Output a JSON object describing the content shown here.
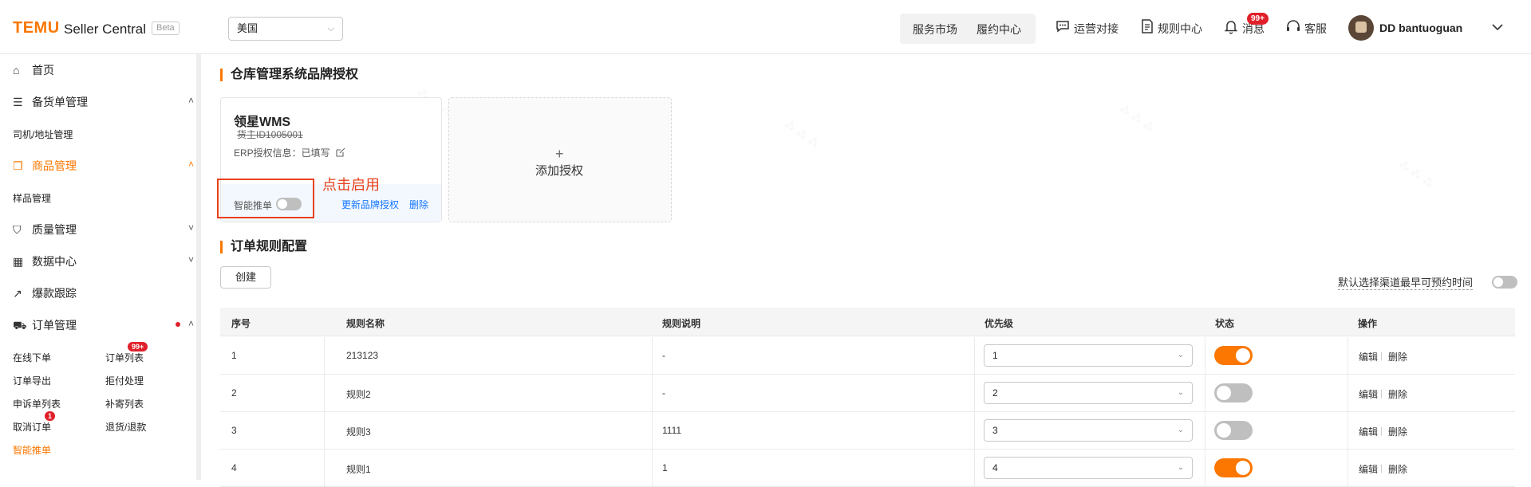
{
  "header": {
    "logo": "TEMU",
    "brand": "Seller Central",
    "beta": "Beta",
    "region": "美国",
    "links": {
      "service_market": "服务市场",
      "fulfillment": "履约中心",
      "operations": "运营对接",
      "rules": "规则中心",
      "messages": "消息",
      "support": "客服"
    },
    "message_badge": "99+",
    "username": "DD bantuoguan"
  },
  "sidebar": {
    "home": "首页",
    "stock": "备货单管理",
    "driver": "司机/地址管理",
    "product": "商品管理",
    "sample": "样品管理",
    "quality": "质量管理",
    "data": "数据中心",
    "hot": "爆款跟踪",
    "order": "订单管理",
    "order_items": {
      "online_order": "在线下单",
      "order_list": "订单列表",
      "order_list_badge": "99+",
      "order_export": "订单导出",
      "reject": "拒付处理",
      "appeal": "申诉单列表",
      "reship": "补寄列表",
      "cancel": "取消订单",
      "cancel_badge": "1",
      "refund": "退货/退款",
      "smart": "智能推单"
    }
  },
  "warehouse": {
    "title": "仓库管理系统品牌授权",
    "card": {
      "name": "领星WMS",
      "owner_id": "货主ID1005001",
      "erp_info": "ERP授权信息：已填写",
      "smart_label": "智能推单",
      "smart_on": false,
      "update": "更新品牌授权",
      "delete": "删除"
    },
    "annotation": "点击启用",
    "add_label": "添加授权"
  },
  "rules": {
    "title": "订单规则配置",
    "create": "创建",
    "default_channel": "默认选择渠道最早可预约时间",
    "columns": [
      "序号",
      "规则名称",
      "规则说明",
      "优先级",
      "状态",
      "操作"
    ],
    "rows": [
      {
        "no": "1",
        "name": "213123",
        "desc": "-",
        "priority": "1",
        "enabled": true,
        "edit": "编辑",
        "delete": "删除"
      },
      {
        "no": "2",
        "name": "规则2",
        "desc": "-",
        "priority": "2",
        "enabled": false,
        "edit": "编辑",
        "delete": "删除"
      },
      {
        "no": "3",
        "name": "规则3",
        "desc": "1111",
        "priority": "3",
        "enabled": false,
        "edit": "编辑",
        "delete": "删除"
      },
      {
        "no": "4",
        "name": "规则1",
        "desc": "1",
        "priority": "4",
        "enabled": true,
        "edit": "编辑",
        "delete": "删除"
      }
    ]
  },
  "colors": {
    "accent": "#fb7701",
    "link": "#1677ff",
    "annotation": "#e8401c"
  }
}
